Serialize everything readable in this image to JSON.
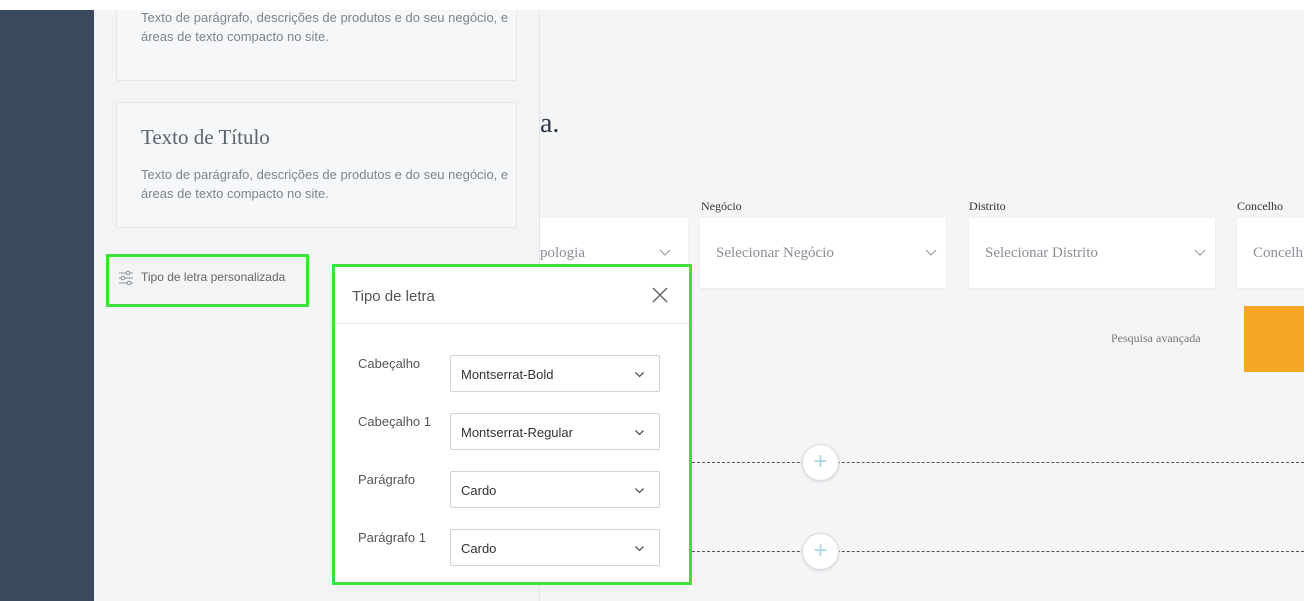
{
  "panel": {
    "cards": [
      {
        "title": "",
        "description": "Texto de parágrafo, descrições de produtos e do seu negócio, e áreas de texto compacto no site."
      },
      {
        "title": "Texto de Título",
        "description": "Texto de parágrafo, descrições de produtos e do seu negócio, e áreas de texto compacto no site."
      }
    ],
    "custom_font_label": "Tipo de letra personalizada"
  },
  "main": {
    "heading_fragment": "a.",
    "fields": [
      {
        "label": "",
        "value": "pologia"
      },
      {
        "label": "Negócio",
        "value": "Selecionar Negócio"
      },
      {
        "label": "Distrito",
        "value": "Selecionar Distrito"
      },
      {
        "label": "Concelho",
        "value": "Concelh"
      }
    ],
    "advanced_search": "Pesquisa avançada"
  },
  "dialog": {
    "title": "Tipo de letra",
    "rows": [
      {
        "label": "Cabeçalho",
        "value": "Montserrat-Bold"
      },
      {
        "label": "Cabeçalho 1",
        "value": "Montserrat-Regular"
      },
      {
        "label": "Parágrafo",
        "value": "Cardo"
      },
      {
        "label": "Parágrafo 1",
        "value": "Cardo"
      }
    ]
  },
  "colors": {
    "highlight": "#3ee03b",
    "sidebar": "#3c4a60",
    "accent": "#f5a623"
  },
  "icons": {
    "custom_font": "sliders-icon",
    "close": "close-icon",
    "chevron": "chevron-down-icon",
    "add": "plus-icon"
  }
}
